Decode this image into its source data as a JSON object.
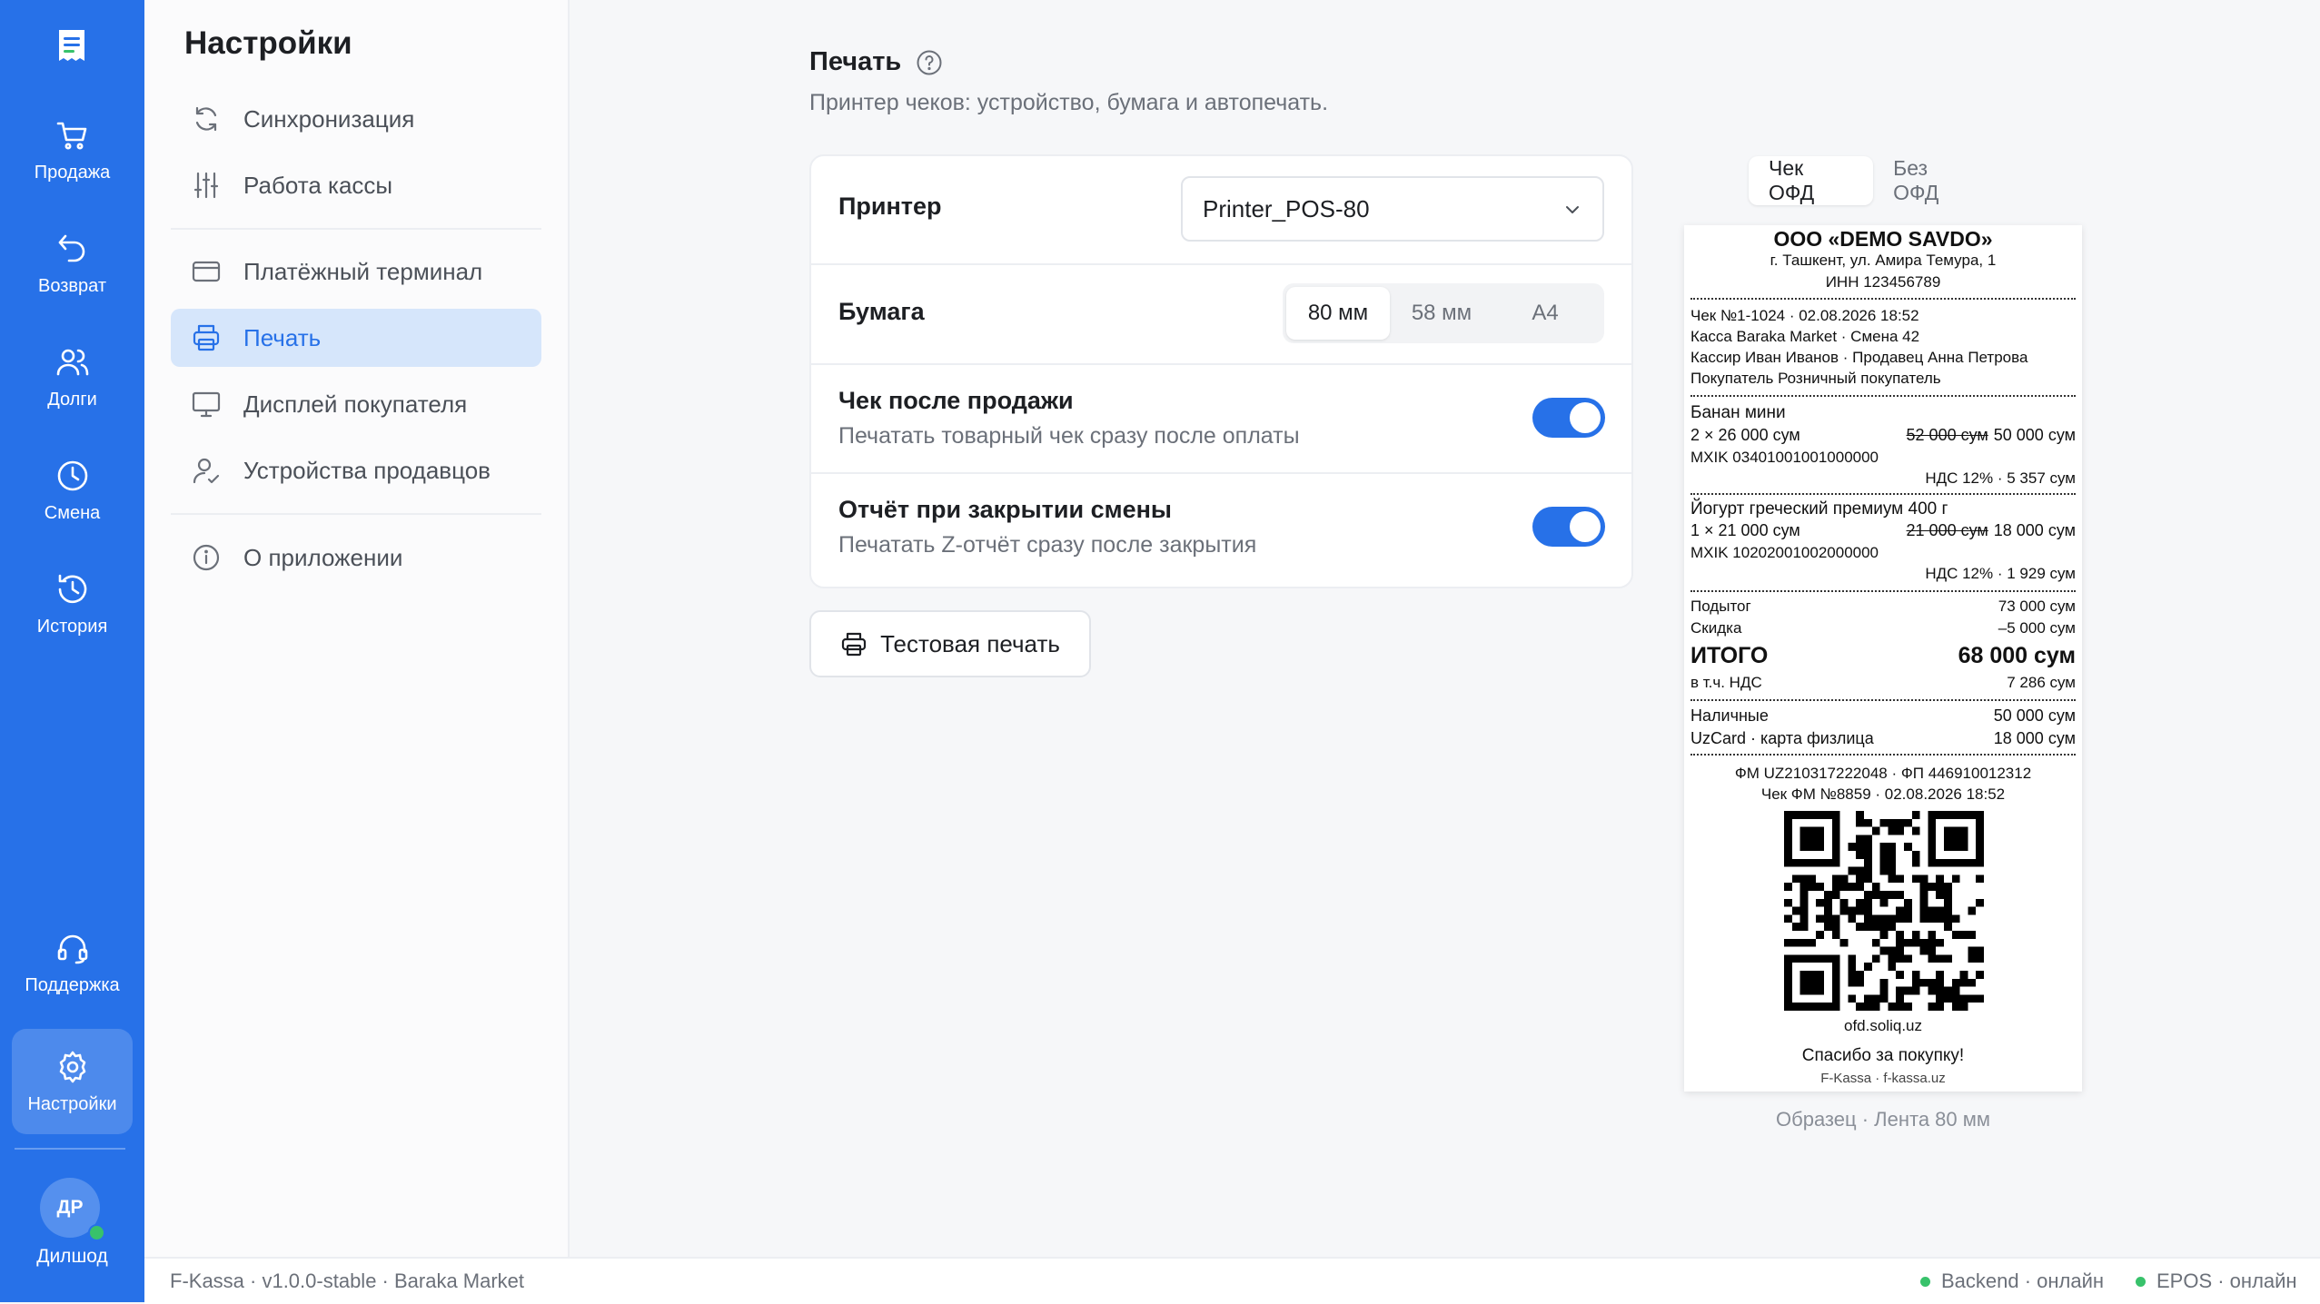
{
  "rail": {
    "items": [
      {
        "label": "Продажа",
        "icon": "cart-icon"
      },
      {
        "label": "Возврат",
        "icon": "undo-icon"
      },
      {
        "label": "Долги",
        "icon": "users-icon"
      },
      {
        "label": "Смена",
        "icon": "clock-icon"
      },
      {
        "label": "История",
        "icon": "history-icon"
      },
      {
        "label": "Поддержка",
        "icon": "headset-icon"
      },
      {
        "label": "Настройки",
        "icon": "gear-icon"
      }
    ],
    "user": {
      "initials": "ДР",
      "name": "Дилшод"
    }
  },
  "sidebar": {
    "title": "Настройки",
    "items": [
      {
        "label": "Синхронизация",
        "icon": "sync-icon"
      },
      {
        "label": "Работа кассы",
        "icon": "sliders-icon"
      },
      {
        "label": "Платёжный терминал",
        "icon": "card-icon"
      },
      {
        "label": "Печать",
        "icon": "printer-icon"
      },
      {
        "label": "Дисплей покупателя",
        "icon": "monitor-icon"
      },
      {
        "label": "Устройства продавцов",
        "icon": "user-device-icon"
      },
      {
        "label": "О приложении",
        "icon": "info-icon"
      }
    ],
    "active": "Печать"
  },
  "main": {
    "title": "Печать",
    "subtitle": "Принтер чеков: устройство, бумага и автопечать.",
    "printer": {
      "label": "Принтер",
      "value": "Printer_POS-80"
    },
    "paper": {
      "label": "Бумага",
      "options": [
        "80 мм",
        "58 мм",
        "A4"
      ],
      "selected": "80 мм"
    },
    "receipt_after_sale": {
      "label": "Чек после продажи",
      "desc": "Печатать товарный чек сразу после оплаты",
      "enabled": true
    },
    "z_report": {
      "label": "Отчёт при закрытии смены",
      "desc": "Печатать Z-отчёт сразу после закрытия",
      "enabled": true
    },
    "test_button": "Тестовая печать"
  },
  "preview": {
    "tabs": [
      "Чек ОФД",
      "Без ОФД"
    ],
    "active_tab": "Чек ОФД",
    "caption": "Образец · Лента 80 мм",
    "receipt": {
      "company": "ООО «DEMO SAVDO»",
      "address": "г. Ташкент, ул. Амира Темура, 1",
      "inn": "ИНН 123456789",
      "check_line": "Чек №1-1024 · 02.08.2026 18:52",
      "register_line": "Касса Baraka Market · Смена 42",
      "cashier_line": "Кассир Иван Иванов · Продавец Анна Петрова",
      "buyer_line": "Покупатель Розничный покупатель",
      "items": [
        {
          "name": "Банан мини",
          "qty": "2 × 26 000 сум",
          "old": "52 000 сум",
          "total": "50 000 сум",
          "mxik": "MXIK 03401001001000000",
          "vat": "НДС 12% · 5 357 сум"
        },
        {
          "name": "Йогурт греческий премиум 400 г",
          "qty": "1 × 21 000 сум",
          "old": "21 000 сум",
          "total": "18 000 сум",
          "mxik": "MXIK 10202001002000000",
          "vat": "НДС 12% · 1 929 сум"
        }
      ],
      "subtotal_label": "Подытог",
      "subtotal": "73 000 сум",
      "discount_label": "Скидка",
      "discount": "–5 000 сум",
      "total_label": "ИТОГО",
      "total": "68 000 сум",
      "vat_label": "в т.ч. НДС",
      "vat": "7 286 сум",
      "cash_label": "Наличные",
      "cash": "50 000 сум",
      "card_label": "UzCard · карта физлица",
      "card": "18 000 сум",
      "fm_line": "ФМ UZ210317222048 · ФП 446910012312",
      "fm_check_line": "Чек ФМ №8859 · 02.08.2026 18:52",
      "ofd_url": "ofd.soliq.uz",
      "thanks": "Спасибо за покупку!",
      "footer": "F-Kassa · f-kassa.uz"
    }
  },
  "statusbar": {
    "left": "F-Kassa · v1.0.0-stable · Baraka Market",
    "backend": "Backend · онлайн",
    "epos": "EPOS · онлайн"
  },
  "colors": {
    "accent": "#2771e8",
    "online": "#38c26b"
  }
}
